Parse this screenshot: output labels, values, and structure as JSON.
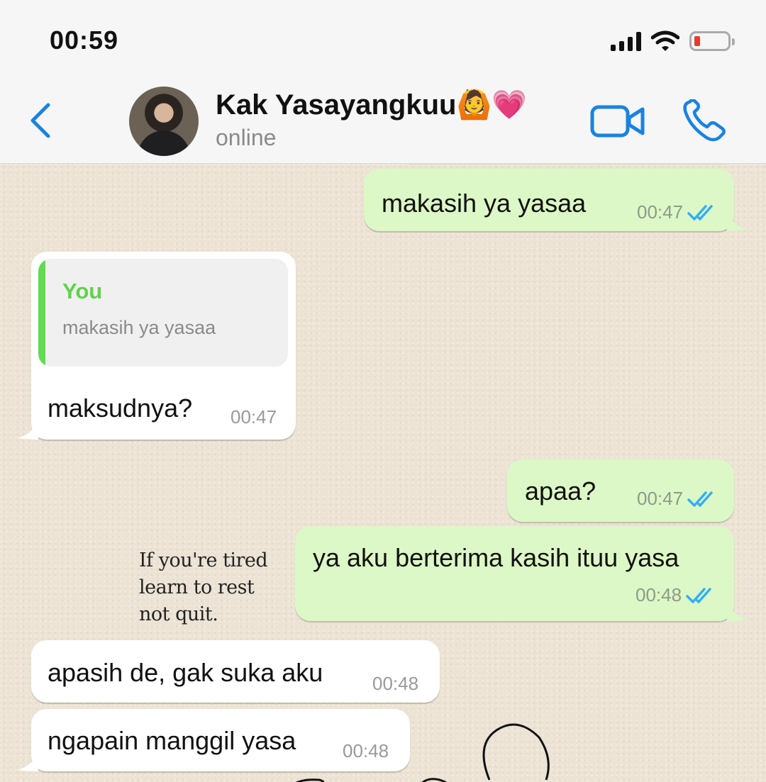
{
  "status_bar": {
    "time": "00:59"
  },
  "header": {
    "contact_name": "Kak Yasayangkuu",
    "contact_emoji": "🙆💗",
    "contact_status": "online",
    "icons": {
      "back": "chevron-left-icon",
      "video": "video-camera-icon",
      "call": "phone-icon"
    },
    "accent_color": "#1a82e0"
  },
  "background_quote": [
    "If you're tired",
    "learn to rest",
    "not quit."
  ],
  "messages": [
    {
      "direction": "outgoing",
      "text": "makasih ya yasaa",
      "time": "00:47",
      "status": "read"
    },
    {
      "direction": "incoming",
      "reply_to": {
        "author": "You",
        "text": "makasih ya yasaa"
      },
      "text": "maksudnya?",
      "time": "00:47"
    },
    {
      "direction": "outgoing",
      "text": "apaa?",
      "time": "00:47",
      "status": "read"
    },
    {
      "direction": "outgoing",
      "text": "ya aku berterima kasih ituu yasa",
      "time": "00:48",
      "status": "read"
    },
    {
      "direction": "incoming",
      "text": "apasih de, gak suka aku",
      "time": "00:48"
    },
    {
      "direction": "incoming",
      "text": "ngapain manggil yasa",
      "time": "00:48"
    }
  ],
  "colors": {
    "outgoing_bubble": "#dcf8c6",
    "incoming_bubble": "#ffffff",
    "read_ticks": "#34aef5",
    "reply_accent": "#5fdc4f"
  }
}
